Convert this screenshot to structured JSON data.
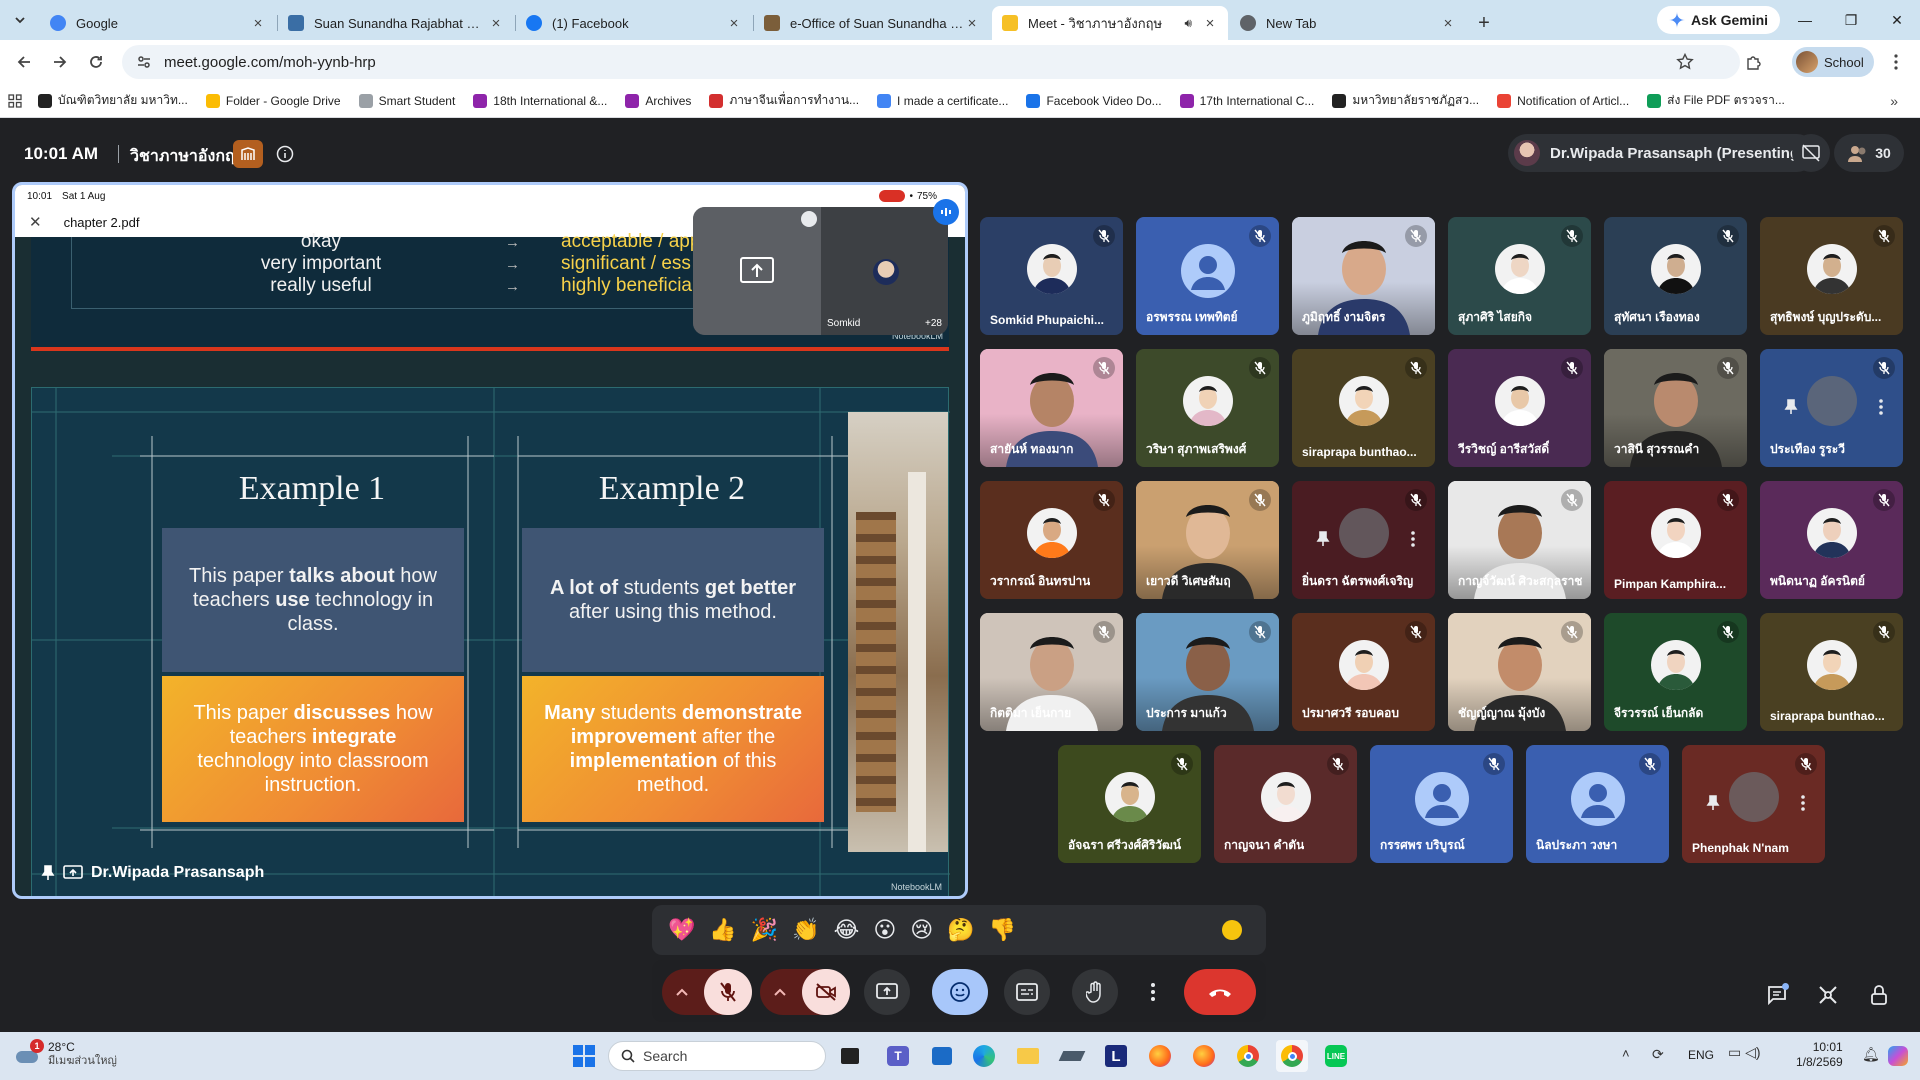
{
  "browser": {
    "tabs": [
      {
        "title": "Google",
        "active": false
      },
      {
        "title": "Suan Sunandha Rajabhat University",
        "active": false
      },
      {
        "title": "(1) Facebook",
        "active": false
      },
      {
        "title": "e-Office of Suan Sunandha Rajabhat",
        "active": false
      },
      {
        "title": "Meet - วิชาภาษาอังกฤษ",
        "active": true
      },
      {
        "title": "New Tab",
        "active": false
      }
    ],
    "ask_gemini": "Ask Gemini",
    "url": "meet.google.com/moh-yynb-hrp",
    "profile_label": "School",
    "bookmarks": [
      "บัณฑิตวิทยาลัย มหาวิท...",
      "Folder - Google Drive",
      "Smart Student",
      "18th International &...",
      "Archives",
      "ภาษาจีนเพื่อการทำงาน...",
      "I made a certificate...",
      "Facebook Video Do...",
      "17th International C...",
      "มหาวิทยาลัยราชภัฏสว...",
      "Notification of Articl...",
      "ส่ง File PDF ตรวจรา..."
    ]
  },
  "meet": {
    "time": "10:01 AM",
    "title": "วิชาภาษาอังกฤษ",
    "presenter_chip": "Dr.Wipada Prasansaph (Presenting)",
    "participant_count": "30",
    "presentation": {
      "ipad_time": "10:01",
      "ipad_date": "Sat 1 Aug",
      "battery": "75%",
      "pdf_name": "chapter 2.pdf",
      "rows": [
        {
          "left": "okay",
          "right": "acceptable / appr"
        },
        {
          "left": "very important",
          "right": "significant / ess"
        },
        {
          "left": "really useful",
          "right": "highly beneficial /"
        }
      ],
      "arrow": "→",
      "watermark": "NotebookLM",
      "example1_title": "Example 1",
      "example2_title": "Example 2",
      "example1_top_parts": [
        {
          "t": "This paper ",
          "b": false
        },
        {
          "t": "talks about",
          "b": true
        },
        {
          "t": " how teachers ",
          "b": false
        },
        {
          "t": "use",
          "b": true
        },
        {
          "t": " technology in class.",
          "b": false
        }
      ],
      "example1_bottom_parts": [
        {
          "t": "This paper ",
          "b": false
        },
        {
          "t": "discusses",
          "b": true
        },
        {
          "t": " how teachers ",
          "b": false
        },
        {
          "t": "integrate",
          "b": true
        },
        {
          "t": " technology into classroom instruction.",
          "b": false
        }
      ],
      "example2_top_parts": [
        {
          "t": "A lot of",
          "b": true
        },
        {
          "t": " students ",
          "b": false
        },
        {
          "t": "get better",
          "b": true
        },
        {
          "t": " after using this method.",
          "b": false
        }
      ],
      "example2_bottom_parts": [
        {
          "t": "Many",
          "b": true
        },
        {
          "t": " students ",
          "b": false
        },
        {
          "t": "demonstrate improvement",
          "b": true
        },
        {
          "t": " after the ",
          "b": false
        },
        {
          "t": "implementation",
          "b": true
        },
        {
          "t": " of this method.",
          "b": false
        }
      ],
      "pip_name": "Somkid",
      "pip_more": "+28",
      "presenter_name": "Dr.Wipada Prasansaph"
    },
    "tiles": [
      {
        "name": "Somkid Phupaichi...",
        "bg": "#2b3f66",
        "kind": "photo",
        "skin": "#e8cdb5",
        "cloth": "#1d2c5a"
      },
      {
        "name": "อรพรรณ เทพทิตย์",
        "bg": "#3a5fb0",
        "kind": "default"
      },
      {
        "name": "ภูมิฤทธิ์ งามจิตร",
        "bg": "#c9cfe0",
        "kind": "video",
        "skin": "#d8a98a",
        "cloth": "#2a3a6a"
      },
      {
        "name": "สุภาศิริ ไสยกิจ",
        "bg": "#2c4a4a",
        "kind": "photo",
        "skin": "#eed6c4",
        "cloth": "#ffffff"
      },
      {
        "name": "สุทัศนา เรืองทอง",
        "bg": "#2b3f55",
        "kind": "photo",
        "skin": "#cfae90",
        "cloth": "#111111"
      },
      {
        "name": "สุทธิพงษ์ บุญประดับ...",
        "bg": "#4a3a22",
        "kind": "photo",
        "skin": "#d2b08e",
        "cloth": "#333333"
      },
      {
        "name": "สายันห์ ทองมาก",
        "bg": "#e9b3c7",
        "kind": "video",
        "skin": "#b58466",
        "cloth": "#3b4b7a"
      },
      {
        "name": "วริษา สุภาพเสริพงศ์",
        "bg": "#3d4a2a",
        "kind": "photo",
        "skin": "#f0d2b6",
        "cloth": "#e3b8c8"
      },
      {
        "name": "siraprapa bunthao...",
        "bg": "#4a4022",
        "kind": "photo",
        "skin": "#f2d4b8",
        "cloth": "#c69a5a"
      },
      {
        "name": "วีรวิชญ์ อารีสวัสดิ์",
        "bg": "#4a2a52",
        "kind": "photo",
        "skin": "#e8c8a8",
        "cloth": "#ffffff"
      },
      {
        "name": "วาสินี สุวรรณคำ",
        "bg": "#6c6a60",
        "kind": "video",
        "skin": "#b98a6e",
        "cloth": "#222222"
      },
      {
        "name": "ประเทือง รูระวี",
        "bg": "#2f4f8a",
        "kind": "pinned"
      },
      {
        "name": "วรากรณ์ อินทรปาน",
        "bg": "#5a2e1e",
        "kind": "photo",
        "skin": "#d9a983",
        "cloth": "#ff7a1a"
      },
      {
        "name": "เยาวดี วิเศษสัมฤ",
        "bg": "#caa070",
        "kind": "video",
        "skin": "#e0b896",
        "cloth": "#2a2a2a"
      },
      {
        "name": "ยิ่นดรา ฉัตรพงศ์เจริญ",
        "bg": "#4a1c22",
        "kind": "pinned"
      },
      {
        "name": "กาญจ์วัฒน์ ศิวะสกุลราช",
        "bg": "#e8e8e8",
        "kind": "video",
        "skin": "#a87856",
        "cloth": "#e6e6e6"
      },
      {
        "name": "Pimpan Kamphira...",
        "bg": "#5a1e22",
        "kind": "photo",
        "skin": "#f2d4c0",
        "cloth": "#ffffff"
      },
      {
        "name": "พนิดนาฏ อัครนิตย์",
        "bg": "#5a2a5a",
        "kind": "photo",
        "skin": "#eed0bc",
        "cloth": "#22335a"
      },
      {
        "name": "กิตติมา เย็นกาย",
        "bg": "#cfc4ba",
        "kind": "video",
        "skin": "#caa084",
        "cloth": "#f0f0f0"
      },
      {
        "name": "ประการ มาแก้ว",
        "bg": "#6a9bc2",
        "kind": "video",
        "skin": "#8a6048",
        "cloth": "#333333"
      },
      {
        "name": "ปรมาศวรี รอบคอบ",
        "bg": "#5a2e1e",
        "kind": "photo",
        "skin": "#f0d0b4",
        "cloth": "#f2c6b6"
      },
      {
        "name": "ชัญญ์ญาณ มุ้งบัง",
        "bg": "#e2d2be",
        "kind": "video",
        "skin": "#c28c6a",
        "cloth": "#2a2a2a"
      },
      {
        "name": "จีรวรรณ์ เย็นกลัด",
        "bg": "#1e4a2a",
        "kind": "photo",
        "skin": "#f0d4c0",
        "cloth": "#2a5a3a"
      },
      {
        "name": "siraprapa bunthao...",
        "bg": "#4a4022",
        "kind": "photo",
        "skin": "#f2d4b8",
        "cloth": "#c69a5a"
      },
      {
        "name": "อัจฉรา ศรีวงศ์ศิริวัฒน์",
        "bg": "#3d4a1e",
        "kind": "photo",
        "skin": "#d8b48c",
        "cloth": "#6a8a4a"
      },
      {
        "name": "กาญจนา คำตัน",
        "bg": "#5a2a2a",
        "kind": "photo",
        "skin": "#f2dcd0",
        "cloth": "#f8f0f0"
      },
      {
        "name": "กรรศพร บริบูรณ์",
        "bg": "#3a5fb0",
        "kind": "default"
      },
      {
        "name": "นิลประภา วงษา",
        "bg": "#3a5fb0",
        "kind": "default"
      },
      {
        "name": "Phenphak N'nam",
        "bg": "#6a2a24",
        "kind": "pinned"
      }
    ],
    "reactions": [
      "💖",
      "👍",
      "🎉",
      "👏",
      "😂",
      "😮",
      "😢",
      "🤔",
      "👎"
    ]
  },
  "taskbar": {
    "weather_temp": "28°C",
    "weather_desc": "มีเมฆส่วนใหญ่",
    "weather_badge": "1",
    "search_placeholder": "Search",
    "lang": "ENG",
    "clock_time": "10:01",
    "clock_date": "1/8/2569"
  }
}
